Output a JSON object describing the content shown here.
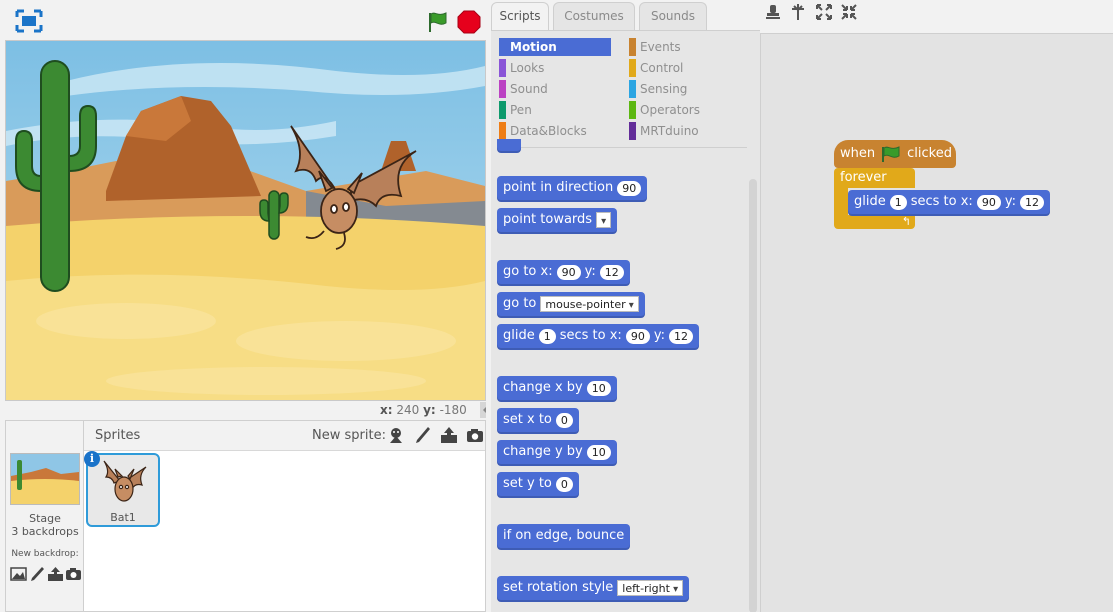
{
  "stage": {
    "coords": {
      "x_label": "x:",
      "x_value": "240",
      "y_label": "y:",
      "y_value": "-180"
    }
  },
  "tabs": [
    {
      "label": "Scripts",
      "active": true
    },
    {
      "label": "Costumes",
      "active": false
    },
    {
      "label": "Sounds",
      "active": false
    }
  ],
  "categories": [
    {
      "label": "Motion",
      "color": "#4a6cd4",
      "active": true
    },
    {
      "label": "Looks",
      "color": "#8a55d7",
      "active": false
    },
    {
      "label": "Sound",
      "color": "#bb42c3",
      "active": false
    },
    {
      "label": "Pen",
      "color": "#0e9a6c",
      "active": false
    },
    {
      "label": "Data&Blocks",
      "color": "#ee7d16",
      "active": false
    },
    {
      "label": "Events",
      "color": "#c88330",
      "active": false
    },
    {
      "label": "Control",
      "color": "#e1a91a",
      "active": false
    },
    {
      "label": "Sensing",
      "color": "#2ca5e2",
      "active": false
    },
    {
      "label": "Operators",
      "color": "#5cb712",
      "active": false
    },
    {
      "label": "MRTduino",
      "color": "#632d99",
      "active": false
    }
  ],
  "palette_blocks": {
    "point_direction": {
      "text": "point in direction",
      "value": "90"
    },
    "point_towards": {
      "text": "point towards",
      "value": ""
    },
    "goto_xy": {
      "text1": "go to x:",
      "x": "90",
      "text2": "y:",
      "y": "12"
    },
    "goto": {
      "text": "go to",
      "value": "mouse-pointer"
    },
    "glide": {
      "text1": "glide",
      "secs": "1",
      "text2": "secs to x:",
      "x": "90",
      "text3": "y:",
      "y": "12"
    },
    "change_x": {
      "text": "change x by",
      "value": "10"
    },
    "set_x": {
      "text": "set x to",
      "value": "0"
    },
    "change_y": {
      "text": "change y by",
      "value": "10"
    },
    "set_y": {
      "text": "set y to",
      "value": "0"
    },
    "bounce": {
      "text": "if on edge, bounce"
    },
    "rotation": {
      "text": "set rotation style",
      "value": "left-right"
    }
  },
  "script": {
    "hat_when": "when",
    "hat_clicked": "clicked",
    "forever": "forever",
    "glide": {
      "text1": "glide",
      "secs": "1",
      "text2": "secs to x:",
      "x": "90",
      "text3": "y:",
      "y": "12"
    }
  },
  "sprites": {
    "title": "Sprites",
    "new_sprite": "New sprite:",
    "stage_label": "Stage",
    "backdrops": "3 backdrops",
    "new_backdrop": "New backdrop:",
    "sprite_name": "Bat1",
    "info_glyph": "i"
  },
  "colors": {
    "motion": "#4a6cd4",
    "events": "#c88330",
    "control": "#e1a91a",
    "selection": "#2f9bd9",
    "stop": "#e6001c"
  }
}
